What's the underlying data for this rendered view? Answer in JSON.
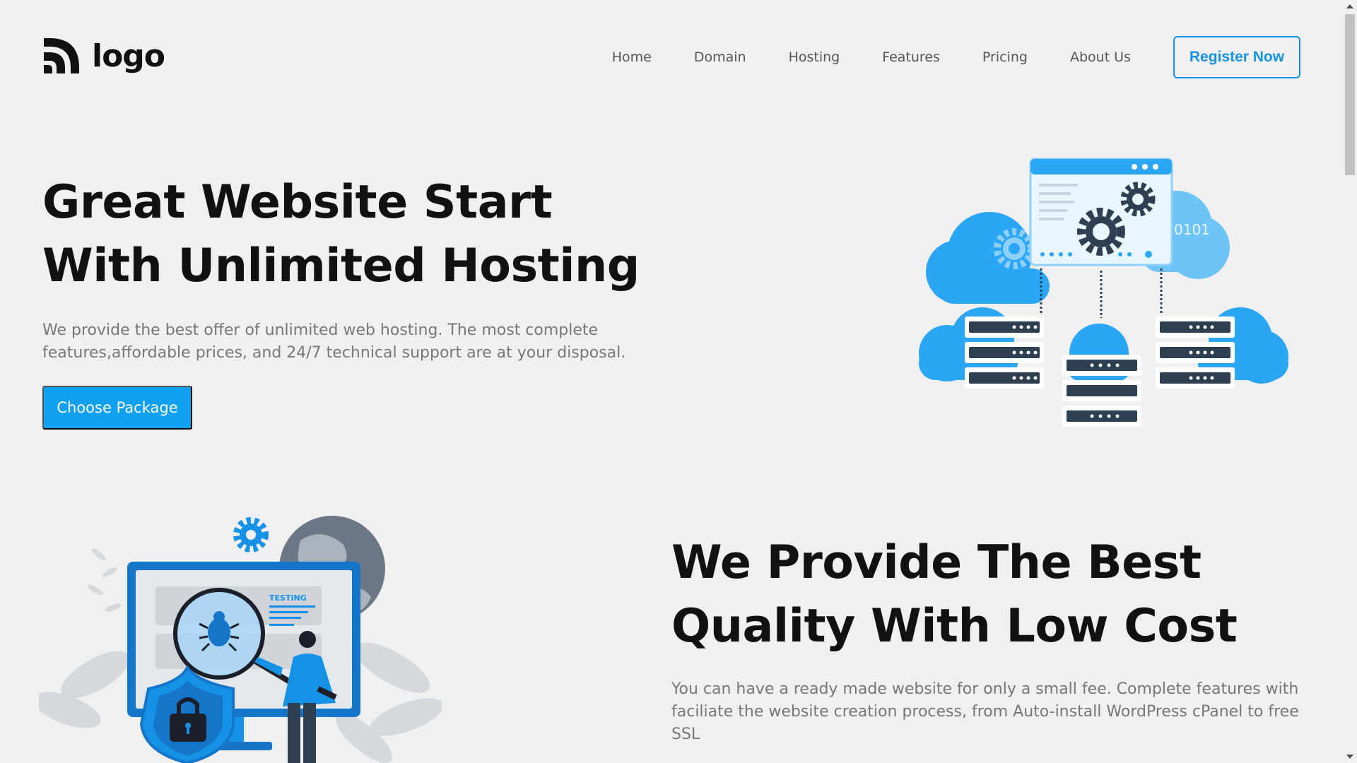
{
  "header": {
    "logo_text": "logo",
    "nav": [
      "Home",
      "Domain",
      "Hosting",
      "Features",
      "Pricing",
      "About Us"
    ],
    "register_label": "Register Now"
  },
  "hero": {
    "title": "Great Website Start With Unlimited Hosting",
    "description": "We provide the best offer of unlimited web hosting. The most complete features,affordable prices, and 24/7 technical support are at your disposal.",
    "cta_label": "Choose Package",
    "illustration_label": "0101"
  },
  "section2": {
    "title": "We Provide The Best Quality With Low Cost",
    "description": "You can have a ready made website for only a small fee. Complete features with faciliate the website creation process, from Auto-install WordPress cPanel to free SSL",
    "illustration_label": "TESTING"
  },
  "colors": {
    "accent": "#0fa0f2",
    "register_border": "#1793e6",
    "background": "#f0f0f0",
    "cloud_blue": "#2aa6f5",
    "server_dark": "#2f3f52"
  },
  "icons": {
    "logo_icon": "logo-mark-icon",
    "hero_illustration": "cloud-hosting-illustration",
    "section2_illustration": "security-testing-illustration"
  }
}
